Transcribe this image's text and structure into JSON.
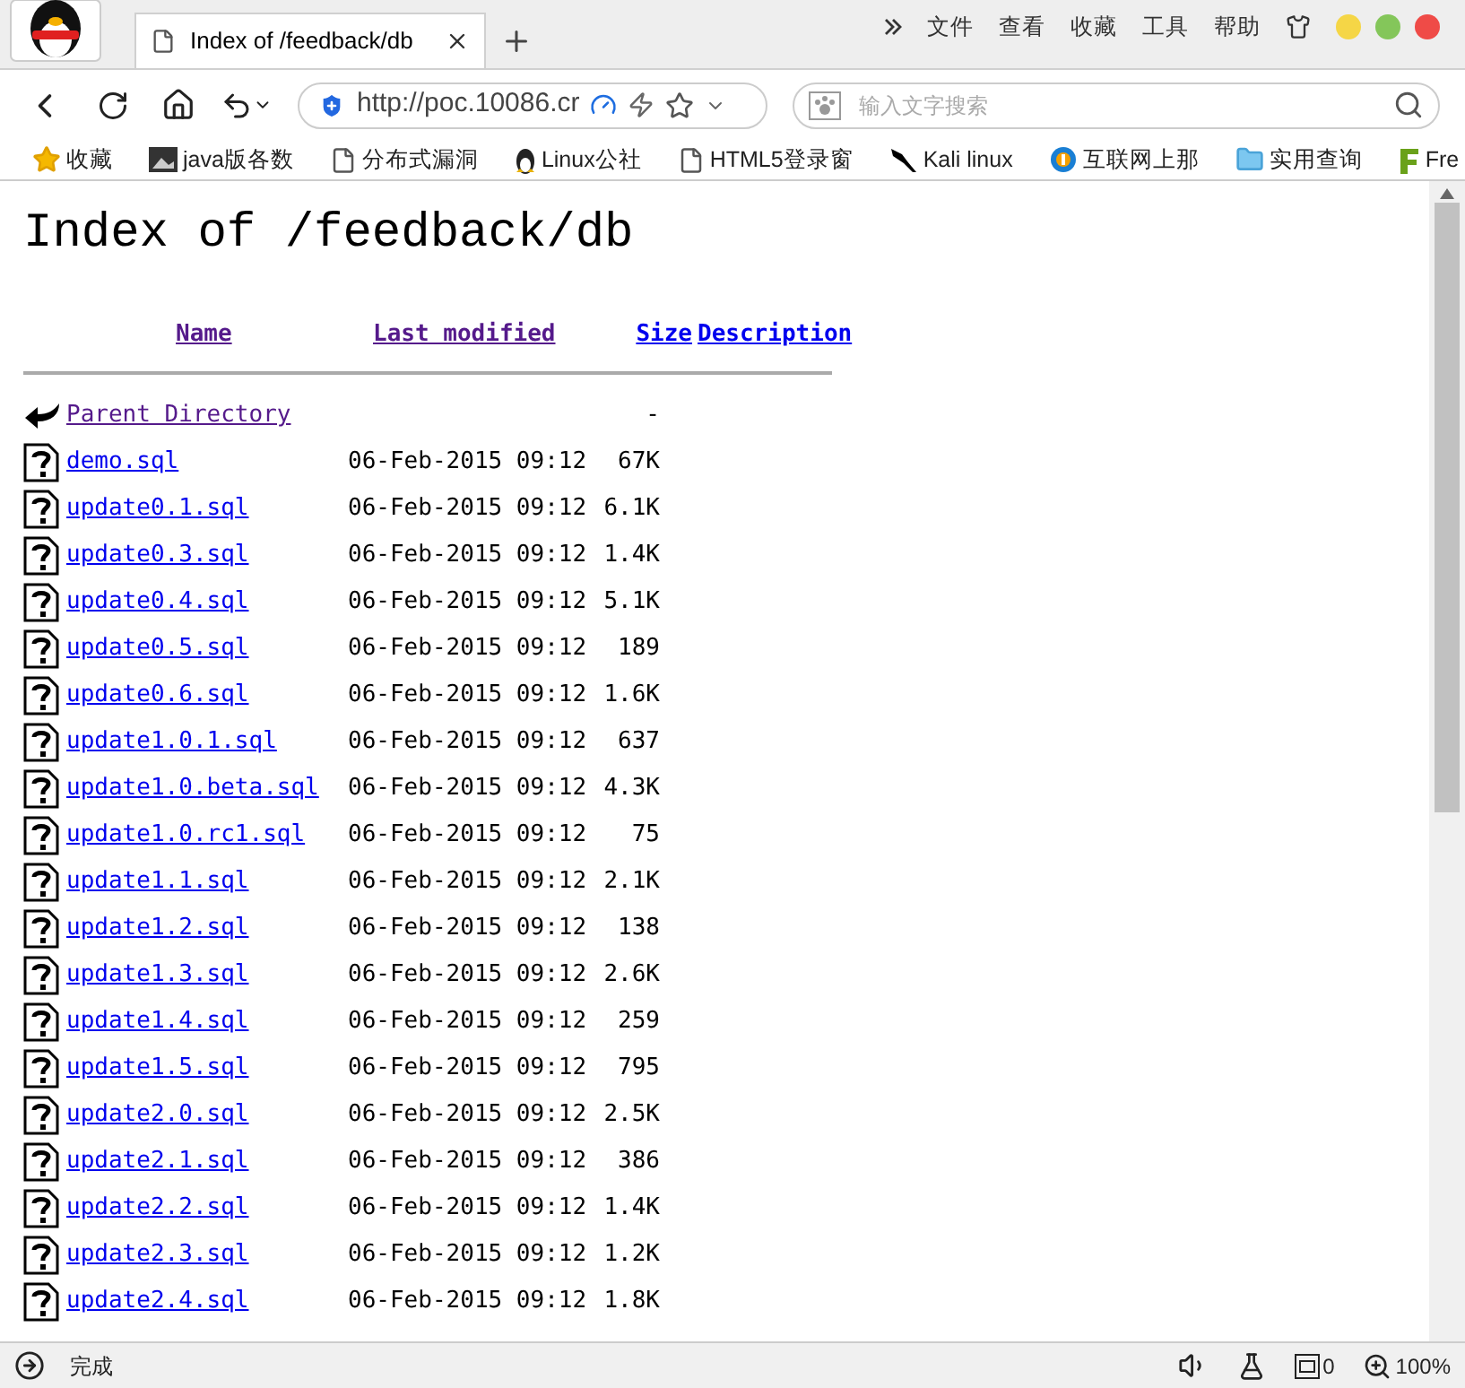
{
  "tab": {
    "title": "Index of /feedback/db"
  },
  "menu": [
    "文件",
    "查看",
    "收藏",
    "工具",
    "帮助"
  ],
  "address": {
    "value": "http://poc.10086.cr"
  },
  "search": {
    "placeholder": "输入文字搜索"
  },
  "bookmarks": [
    {
      "label": "收藏",
      "kind": "star"
    },
    {
      "label": "java版各数",
      "kind": "image"
    },
    {
      "label": "分布式漏洞",
      "kind": "page"
    },
    {
      "label": "Linux公社",
      "kind": "linux"
    },
    {
      "label": "HTML5登录窗",
      "kind": "page"
    },
    {
      "label": "Kali linux",
      "kind": "kali"
    },
    {
      "label": "互联网上那",
      "kind": "circle"
    },
    {
      "label": "实用查询",
      "kind": "folder"
    },
    {
      "label": "Fre",
      "kind": "f"
    }
  ],
  "page": {
    "heading": "Index of /feedback/db",
    "columns": [
      {
        "label": "Name",
        "visited": true
      },
      {
        "label": "Last modified",
        "visited": true
      },
      {
        "label": "Size",
        "visited": false
      },
      {
        "label": "Description",
        "visited": false
      }
    ],
    "rows": [
      {
        "kind": "parent",
        "name": "Parent Directory",
        "visited": true,
        "date": "",
        "size": "-"
      },
      {
        "kind": "file",
        "name": "demo.sql",
        "visited": false,
        "date": "06-Feb-2015 09:12",
        "size": "67K"
      },
      {
        "kind": "file",
        "name": "update0.1.sql",
        "visited": false,
        "date": "06-Feb-2015 09:12",
        "size": "6.1K"
      },
      {
        "kind": "file",
        "name": "update0.3.sql",
        "visited": false,
        "date": "06-Feb-2015 09:12",
        "size": "1.4K"
      },
      {
        "kind": "file",
        "name": "update0.4.sql",
        "visited": false,
        "date": "06-Feb-2015 09:12",
        "size": "5.1K"
      },
      {
        "kind": "file",
        "name": "update0.5.sql",
        "visited": false,
        "date": "06-Feb-2015 09:12",
        "size": "189"
      },
      {
        "kind": "file",
        "name": "update0.6.sql",
        "visited": false,
        "date": "06-Feb-2015 09:12",
        "size": "1.6K"
      },
      {
        "kind": "file",
        "name": "update1.0.1.sql",
        "visited": false,
        "date": "06-Feb-2015 09:12",
        "size": "637"
      },
      {
        "kind": "file",
        "name": "update1.0.beta.sql",
        "visited": false,
        "date": "06-Feb-2015 09:12",
        "size": "4.3K"
      },
      {
        "kind": "file",
        "name": "update1.0.rc1.sql",
        "visited": false,
        "date": "06-Feb-2015 09:12",
        "size": "75"
      },
      {
        "kind": "file",
        "name": "update1.1.sql",
        "visited": false,
        "date": "06-Feb-2015 09:12",
        "size": "2.1K"
      },
      {
        "kind": "file",
        "name": "update1.2.sql",
        "visited": false,
        "date": "06-Feb-2015 09:12",
        "size": "138"
      },
      {
        "kind": "file",
        "name": "update1.3.sql",
        "visited": false,
        "date": "06-Feb-2015 09:12",
        "size": "2.6K"
      },
      {
        "kind": "file",
        "name": "update1.4.sql",
        "visited": false,
        "date": "06-Feb-2015 09:12",
        "size": "259"
      },
      {
        "kind": "file",
        "name": "update1.5.sql",
        "visited": false,
        "date": "06-Feb-2015 09:12",
        "size": "795"
      },
      {
        "kind": "file",
        "name": "update2.0.sql",
        "visited": false,
        "date": "06-Feb-2015 09:12",
        "size": "2.5K"
      },
      {
        "kind": "file",
        "name": "update2.1.sql",
        "visited": false,
        "date": "06-Feb-2015 09:12",
        "size": "386"
      },
      {
        "kind": "file",
        "name": "update2.2.sql",
        "visited": false,
        "date": "06-Feb-2015 09:12",
        "size": "1.4K"
      },
      {
        "kind": "file",
        "name": "update2.3.sql",
        "visited": false,
        "date": "06-Feb-2015 09:12",
        "size": "1.2K"
      },
      {
        "kind": "file",
        "name": "update2.4.sql",
        "visited": false,
        "date": "06-Feb-2015 09:12",
        "size": "1.8K"
      }
    ]
  },
  "status": {
    "text": "完成",
    "counter": "0",
    "zoom": "100%"
  }
}
